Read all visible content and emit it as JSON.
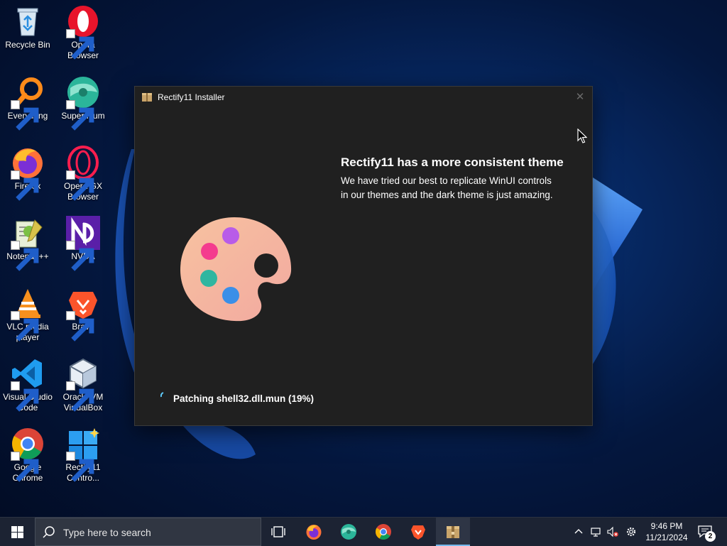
{
  "desktop": {
    "icons": [
      {
        "label": "Recycle Bin"
      },
      {
        "label": "Opera Browser"
      },
      {
        "label": "Everything"
      },
      {
        "label": "Supermium"
      },
      {
        "label": "Firefox"
      },
      {
        "label": "Opera GX Browser"
      },
      {
        "label": "Notepad++"
      },
      {
        "label": "NVDA"
      },
      {
        "label": "VLC media player"
      },
      {
        "label": "Brave"
      },
      {
        "label": "Visual Studio Code"
      },
      {
        "label": "Oracle VM VirtualBox"
      },
      {
        "label": "Google Chrome"
      },
      {
        "label": "Rectify11 Contro..."
      }
    ]
  },
  "installer": {
    "title": "Rectify11 Installer",
    "close_symbol": "✕",
    "heading": "Rectify11 has a more consistent theme",
    "description": "We have tried our best to replicate WinUI controls in our themes and the dark theme is just amazing.",
    "status": "Patching shell32.dll.mun (19%)",
    "progress_percent": 19
  },
  "taskbar": {
    "search_placeholder": "Type here to search",
    "apps": [
      "task-view-icon",
      "firefox-icon",
      "supermium-icon",
      "chrome-icon",
      "brave-icon",
      "rectify11-installer-icon"
    ],
    "clock_time": "9:46 PM",
    "clock_date": "11/21/2024",
    "notification_count": "2"
  },
  "colors": {
    "window_bg": "#202020",
    "taskbar_bg": "#1c2333",
    "accent": "#76b9ed"
  }
}
